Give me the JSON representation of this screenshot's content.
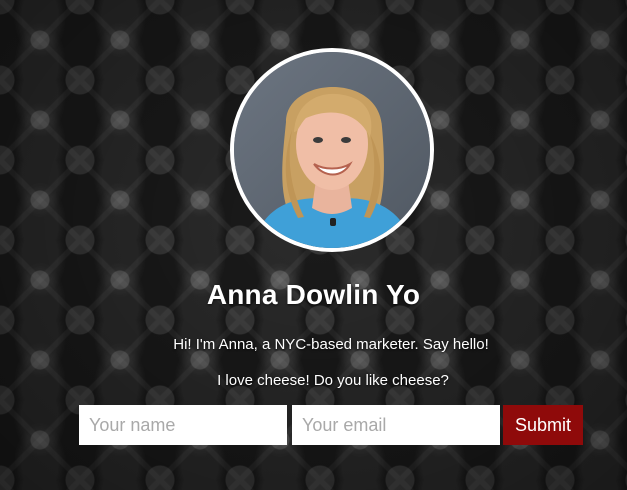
{
  "profile": {
    "name": "Anna Dowlin Yo",
    "bio_line1": "Hi! I'm Anna, a NYC-based marketer. Say hello!",
    "bio_line2": "I love cheese! Do you like cheese?"
  },
  "form": {
    "name_placeholder": "Your name",
    "email_placeholder": "Your email",
    "submit_label": "Submit"
  },
  "colors": {
    "submit_background": "#8f0a0a",
    "page_background": "#1c1c1c",
    "avatar_border": "#ffffff"
  },
  "icons": {
    "avatar": "profile-photo"
  }
}
